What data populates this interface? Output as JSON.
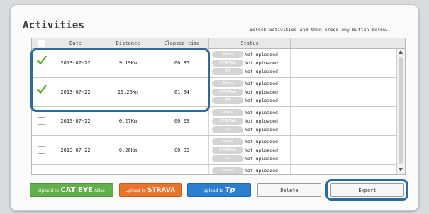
{
  "title": "Activities",
  "hint": "Select activities and then press any button below.",
  "columns": [
    "Date",
    "Distance",
    "Elapsed time",
    "Status"
  ],
  "status_services": [
    "Atlas",
    "STRAVA",
    "TP"
  ],
  "rows": [
    {
      "checked": true,
      "date": "2013-07-22",
      "distance": "9.19Km",
      "elapsed": "00:35",
      "status": [
        "Not uploaded",
        "Not uploaded",
        "Not uploaded"
      ]
    },
    {
      "checked": true,
      "date": "2013-07-22",
      "distance": "19.26Km",
      "elapsed": "01:04",
      "status": [
        "Not uploaded",
        "Not uploaded",
        "Not uploaded"
      ]
    },
    {
      "checked": false,
      "date": "2013-07-22",
      "distance": "0.27Km",
      "elapsed": "00:03",
      "status": [
        "Not uploaded",
        "Not uploaded",
        "Not uploaded"
      ]
    },
    {
      "checked": false,
      "date": "2013-07-22",
      "distance": "0.26Km",
      "elapsed": "00:03",
      "status": [
        "Not uploaded",
        "Not uploaded",
        "Not uploaded"
      ]
    },
    {
      "checked": false,
      "date": "",
      "distance": "",
      "elapsed": "",
      "status": [
        "Not uploaded"
      ]
    }
  ],
  "buttons": {
    "cateye_prefix": "Upload to",
    "cateye_brand": "CAT EYE",
    "cateye_suffix": "Atlas",
    "strava_prefix": "Upload to",
    "strava_brand": "STRAVA",
    "tp_prefix": "Upload to",
    "tp_brand": "Tp",
    "delete": "Delete",
    "export": "Export"
  },
  "colors": {
    "highlight": "#2b6a9c",
    "check": "#5aa53a",
    "cateye": "#62b04a",
    "strava": "#e8732a",
    "trainingpeaks": "#2c7fd0"
  },
  "icons": {
    "check": "check-icon",
    "scroll_up": "chevron-up-icon",
    "scroll_down": "chevron-down-icon"
  }
}
